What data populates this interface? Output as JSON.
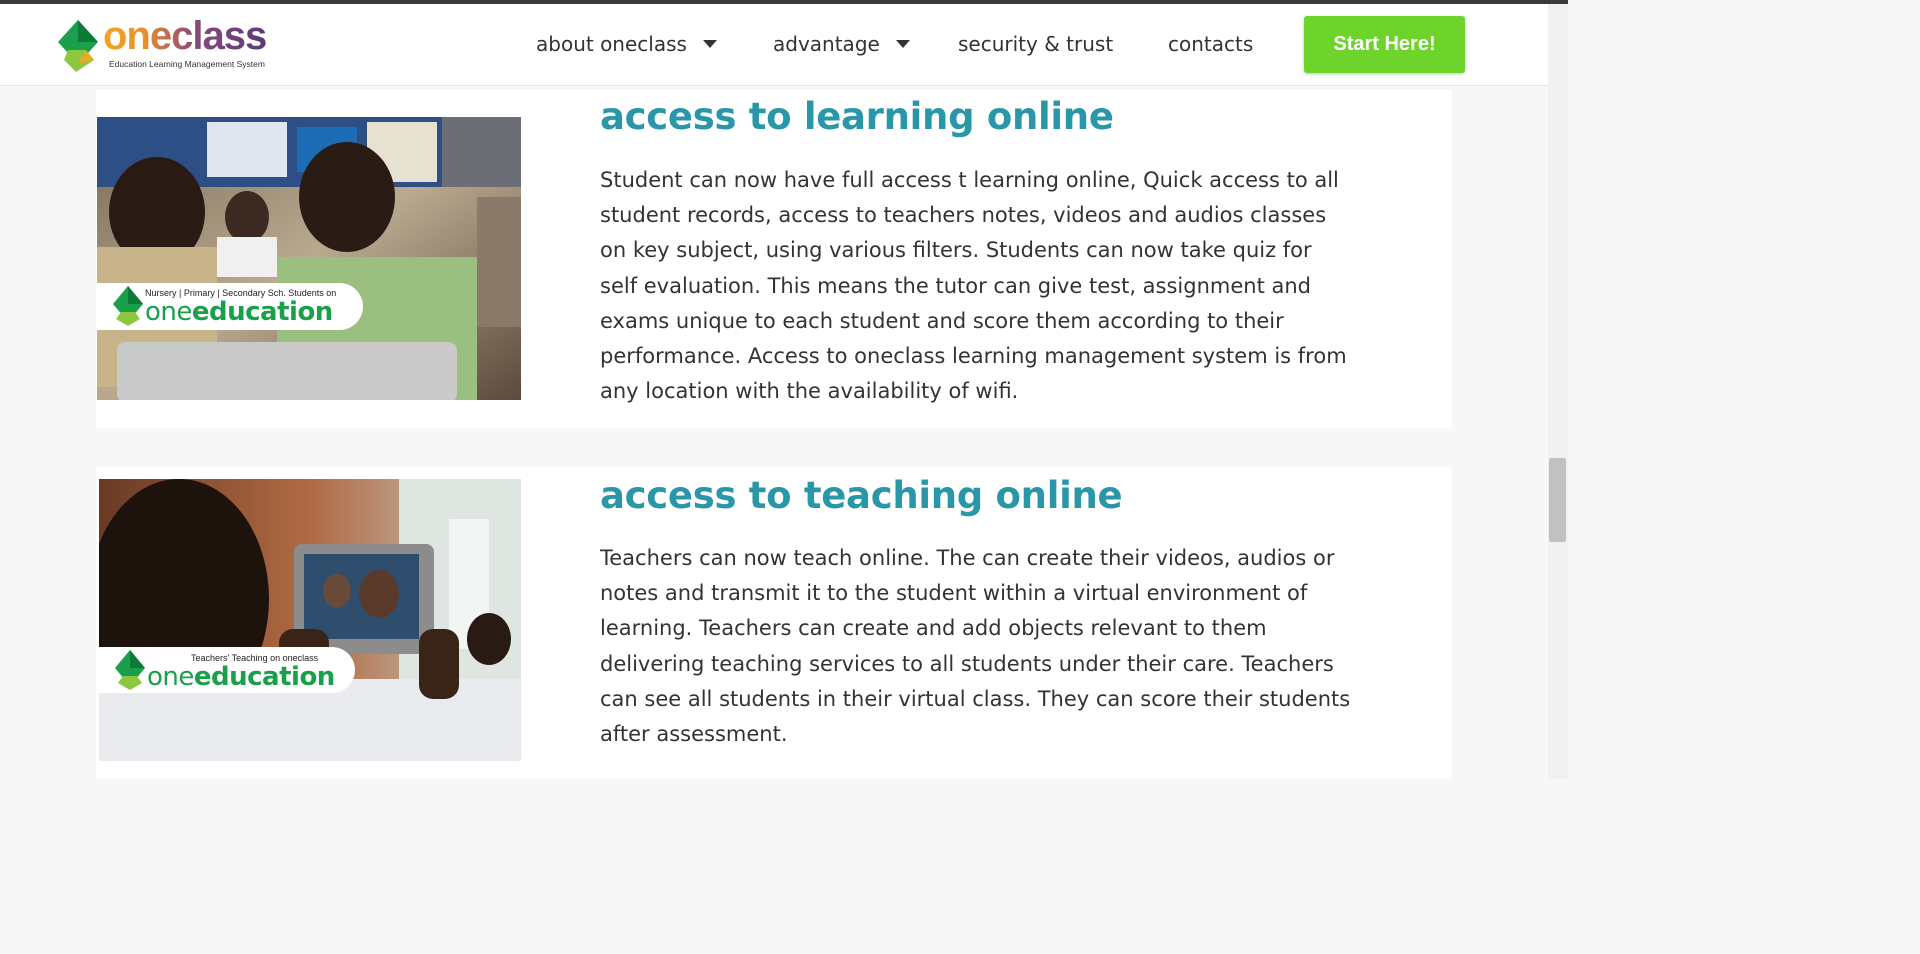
{
  "header": {
    "logo_word": "oneclass",
    "logo_tagline": "Education Learning Management System",
    "nav": [
      {
        "label": "about oneclass",
        "has_dropdown": true
      },
      {
        "label": "advantage",
        "has_dropdown": true
      },
      {
        "label": "security & trust",
        "has_dropdown": false
      },
      {
        "label": "contacts",
        "has_dropdown": false
      }
    ],
    "cta_label": "Start Here!"
  },
  "sections": [
    {
      "title": "access to learning online",
      "body": "Student can now have full access t learning online, Quick access to all\nstudent records, access to teachers notes, videos and audios classes\non key subject, using various filters. Students can now take quiz for\nself evaluation. This means the tutor can give test, assignment and\nexams unique to each student and score them according to their\nperformance. Access to oneclass learning management system is from\nany location with the availability of wifi.",
      "image_badge": {
        "caption": "Nursery | Primary | Secondary Sch. Students on",
        "brand_one": "one",
        "brand_edu": "education"
      }
    },
    {
      "title": "access to teaching online",
      "body": "Teachers can now teach online. The can create their videos, audios or\nnotes and transmit it to the student within a virtual  environment of\nlearning. Teachers can create and add objects relevant to them\ndelivering teaching services to all students under  their care. Teachers\ncan see all students in their virtual class. They  can score their students\nafter assessment.",
      "image_badge": {
        "caption": "Teachers' Teaching on oneclass",
        "brand_one": "one",
        "brand_edu": "education"
      }
    }
  ],
  "colors": {
    "heading": "#2a97a8",
    "cta": "#6ed42b",
    "brand_green": "#1aa04a",
    "logo_orange": "#f5a623",
    "logo_purple": "#5a3a78"
  },
  "icons": [
    "oneclass-logo-icon",
    "dropdown-caret-icon",
    "oneeducation-gem-icon"
  ]
}
